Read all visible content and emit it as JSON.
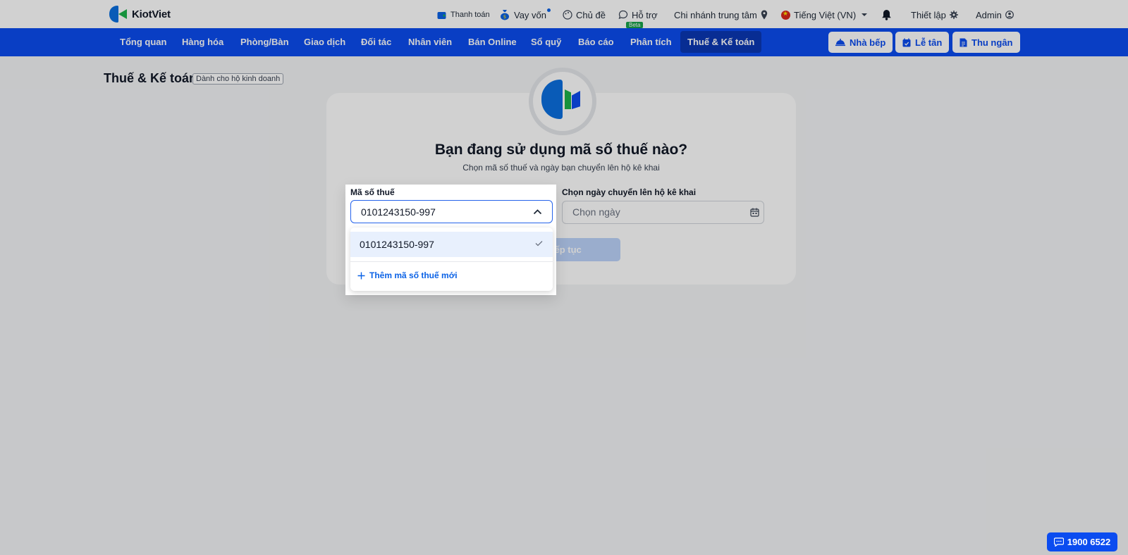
{
  "topbar": {
    "brand": "KiotViet",
    "payment": "Thanh toán",
    "loan": "Vay vốn",
    "theme": "Chủ đề",
    "support": "Hỗ trợ",
    "support_badge": "Beta",
    "branch": "Chi nhánh trung tâm",
    "language": "Tiếng Việt (VN)",
    "settings": "Thiết lập",
    "user": "Admin"
  },
  "nav": {
    "items": [
      "Tổng quan",
      "Hàng hóa",
      "Phòng/Bàn",
      "Giao dịch",
      "Đối tác",
      "Nhân viên",
      "Bán Online",
      "Sổ quỹ",
      "Báo cáo",
      "Phân tích",
      "Thuế & Kế toán"
    ],
    "active": "Thuế & Kế toán",
    "kitchen": "Nhà bếp",
    "reception": "Lễ tân",
    "cashier": "Thu ngân"
  },
  "page": {
    "title": "Thuế & Kế toán",
    "badge": "Dành cho hộ kinh doanh"
  },
  "card": {
    "title": "Bạn đang sử dụng mã số thuế nào?",
    "subtitle": "Chọn mã số thuế và ngày bạn chuyển lên hộ kê khai",
    "tax_label": "Mã số thuế",
    "tax_value": "0101243150-997",
    "date_label": "Chọn ngày chuyển lên hộ kê khai",
    "date_placeholder": "Chọn ngày",
    "continue": "Tiếp tục"
  },
  "dropdown": {
    "options": [
      "0101243150-997"
    ],
    "selected": "0101243150-997",
    "add_new": "Thêm mã số thuế mới"
  },
  "hotline": "1900 6522",
  "colors": {
    "primary": "#0b4cf0",
    "active_nav": "#0a37b4",
    "accent_green": "#1bb24b"
  }
}
